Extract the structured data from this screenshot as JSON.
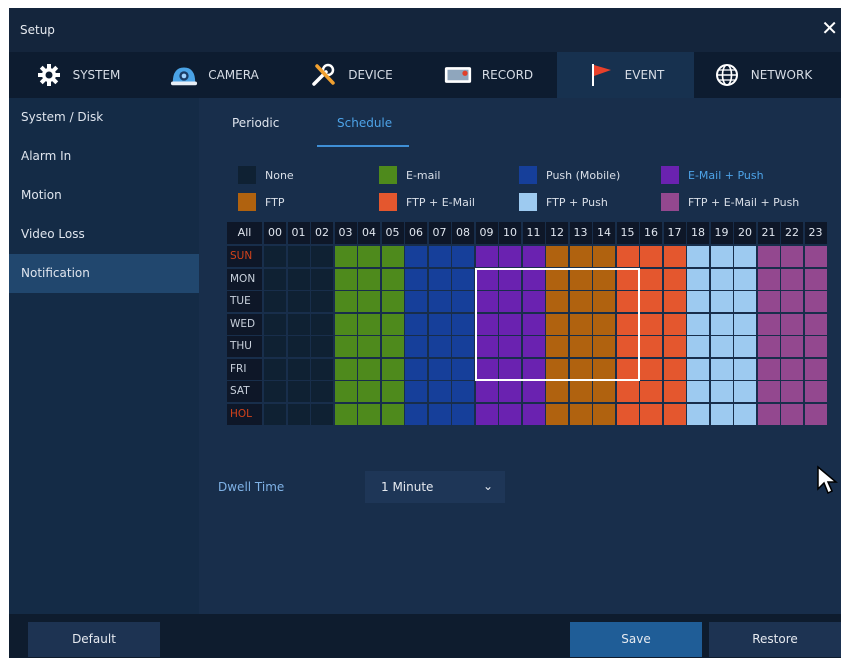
{
  "window": {
    "title": "Setup"
  },
  "tabs": [
    {
      "label": "SYSTEM",
      "icon": "gear-icon"
    },
    {
      "label": "CAMERA",
      "icon": "camera-icon"
    },
    {
      "label": "DEVICE",
      "icon": "tools-icon"
    },
    {
      "label": "RECORD",
      "icon": "record-icon"
    },
    {
      "label": "EVENT",
      "icon": "flag-icon",
      "active": true
    },
    {
      "label": "NETWORK",
      "icon": "globe-icon"
    }
  ],
  "sidebar": {
    "items": [
      {
        "label": "System / Disk"
      },
      {
        "label": "Alarm In"
      },
      {
        "label": "Motion"
      },
      {
        "label": "Video Loss"
      },
      {
        "label": "Notification",
        "active": true
      }
    ]
  },
  "subtabs": [
    {
      "label": "Periodic"
    },
    {
      "label": "Schedule",
      "active": true
    }
  ],
  "legend": [
    {
      "label": "None",
      "color": "#0f2133"
    },
    {
      "label": "E-mail",
      "color": "#4e8a1c"
    },
    {
      "label": "Push (Mobile)",
      "color": "#163f9a"
    },
    {
      "label": "E-Mail + Push",
      "color": "#6a22b0"
    },
    {
      "label": "FTP",
      "color": "#b0620f"
    },
    {
      "label": "FTP + E-Mail",
      "color": "#e4572e"
    },
    {
      "label": "FTP + Push",
      "color": "#9dcaf0"
    },
    {
      "label": "FTP + E-Mail + Push",
      "color": "#93488f"
    }
  ],
  "schedule": {
    "all_label": "All",
    "hours": [
      "00",
      "01",
      "02",
      "03",
      "04",
      "05",
      "06",
      "07",
      "08",
      "09",
      "10",
      "11",
      "12",
      "13",
      "14",
      "15",
      "16",
      "17",
      "18",
      "19",
      "20",
      "21",
      "22",
      "23"
    ],
    "days": [
      {
        "label": "SUN",
        "holiday_color": true
      },
      {
        "label": "MON"
      },
      {
        "label": "TUE"
      },
      {
        "label": "WED"
      },
      {
        "label": "THU"
      },
      {
        "label": "FRI"
      },
      {
        "label": "SAT"
      },
      {
        "label": "HOL",
        "holiday_color": true
      }
    ],
    "hour_modes": [
      0,
      0,
      0,
      1,
      1,
      1,
      2,
      2,
      2,
      3,
      3,
      3,
      4,
      4,
      4,
      5,
      5,
      5,
      6,
      6,
      6,
      7,
      7,
      7
    ],
    "selection": {
      "from_hour": 9,
      "to_hour": 16,
      "from_day": 1,
      "to_day": 5
    }
  },
  "dwell": {
    "label": "Dwell Time",
    "value": "1 Minute"
  },
  "footer": {
    "default_label": "Default",
    "save_label": "Save",
    "restore_label": "Restore"
  }
}
